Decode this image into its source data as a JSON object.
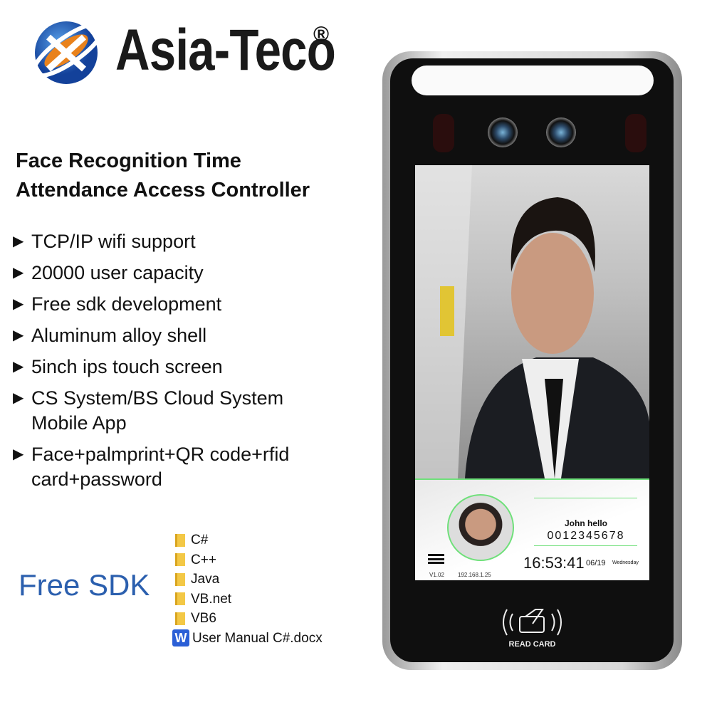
{
  "brand": {
    "name": "Asia-Teco",
    "registered": "®"
  },
  "title": {
    "line1": "Face Recognition Time",
    "line2": "Attendance Access Controller"
  },
  "features": [
    {
      "text": "TCP/IP  wifi support"
    },
    {
      "text": "20000 user capacity"
    },
    {
      "text": "Free sdk development"
    },
    {
      "text": "Aluminum alloy shell"
    },
    {
      "text": "5inch ips touch screen"
    },
    {
      "text": "CS System/BS Cloud System",
      "text2": "Mobile App"
    },
    {
      "text": "Face+palmprint+QR code+rfid",
      "text2": "card+password"
    }
  ],
  "sdk": {
    "label": "Free SDK",
    "folders": [
      "C#",
      "C++",
      "Java",
      "VB.net",
      "VB6"
    ],
    "document": "User Manual C#.docx",
    "doc_icon": "W"
  },
  "device_screen": {
    "greeting": "John  hello",
    "user_id": "0012345678",
    "time": "16:53:41",
    "date": "06/19",
    "weekday": "Wednesday",
    "version": "V1.02",
    "ip": "192.168.1.25",
    "read_card": "READ CARD"
  },
  "colors": {
    "accent_blue": "#2b5fae",
    "logo_orange": "#e9821c",
    "screen_green": "#6fe07a"
  }
}
